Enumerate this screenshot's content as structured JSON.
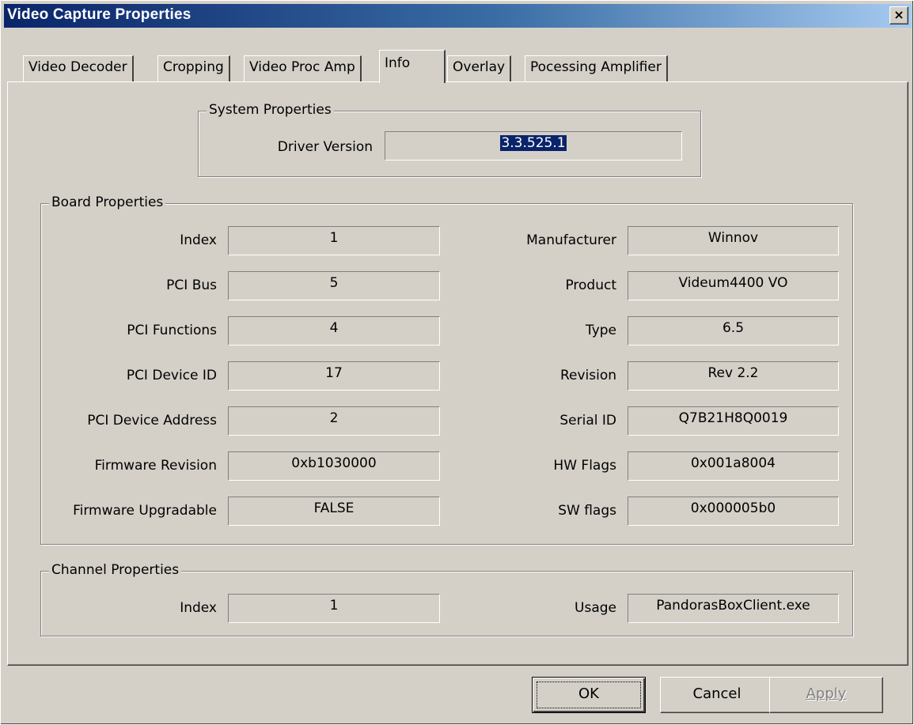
{
  "window": {
    "title": "Video Capture Properties",
    "close_glyph": "×"
  },
  "tabs": [
    {
      "label": "Video Decoder"
    },
    {
      "label": "Cropping"
    },
    {
      "label": "Video Proc Amp"
    },
    {
      "label": "Info",
      "active": true
    },
    {
      "label": "Overlay"
    },
    {
      "label": "Pocessing Amplifier"
    }
  ],
  "system_properties": {
    "title": "System Properties",
    "driver_version_label": "Driver Version",
    "driver_version_value": "3.3.525.1"
  },
  "board_properties": {
    "title": "Board Properties",
    "left": [
      {
        "label": "Index",
        "value": "1"
      },
      {
        "label": "PCI Bus",
        "value": "5"
      },
      {
        "label": "PCI Functions",
        "value": "4"
      },
      {
        "label": "PCI Device ID",
        "value": "17"
      },
      {
        "label": "PCI Device Address",
        "value": "2"
      },
      {
        "label": "Firmware Revision",
        "value": "0xb1030000"
      },
      {
        "label": "Firmware Upgradable",
        "value": "FALSE"
      }
    ],
    "right": [
      {
        "label": "Manufacturer",
        "value": "Winnov"
      },
      {
        "label": "Product",
        "value": "Videum4400 VO"
      },
      {
        "label": "Type",
        "value": "6.5"
      },
      {
        "label": "Revision",
        "value": "Rev 2.2"
      },
      {
        "label": "Serial ID",
        "value": "Q7B21H8Q0019"
      },
      {
        "label": "HW Flags",
        "value": "0x001a8004"
      },
      {
        "label": "SW flags",
        "value": "0x000005b0"
      }
    ]
  },
  "channel_properties": {
    "title": "Channel Properties",
    "index_label": "Index",
    "index_value": "1",
    "usage_label": "Usage",
    "usage_value": "PandorasBoxClient.exe"
  },
  "buttons": {
    "ok": "OK",
    "cancel": "Cancel",
    "apply": "Apply"
  },
  "colors": {
    "face": "#d4d0c8",
    "title_start": "#0a246a",
    "title_end": "#a6caf0",
    "selection": "#0a246a"
  }
}
